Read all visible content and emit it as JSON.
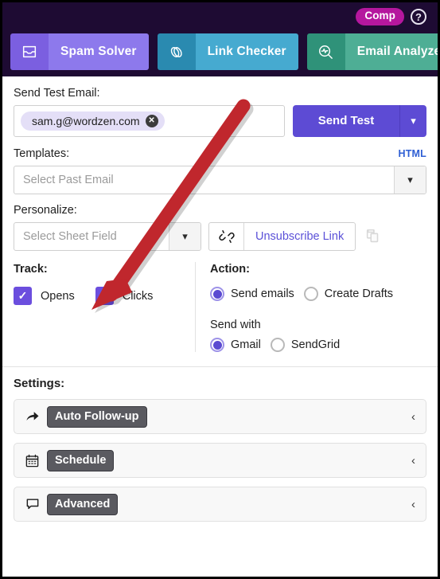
{
  "header": {
    "badge_label": "Comp",
    "help_icon": "question-circle-icon",
    "tools": [
      {
        "icon": "inbox-icon",
        "label": "Spam Solver"
      },
      {
        "icon": "link-icon",
        "label": "Link Checker"
      },
      {
        "icon": "magnifier-pulse-icon",
        "label": "Email Analyzer"
      }
    ]
  },
  "send_test": {
    "label": "Send Test Email:",
    "chip_value": "sam.g@wordzen.com",
    "chip_remove_icon": "close-circle-icon",
    "button_label": "Send Test",
    "button_caret_icon": "chevron-down-icon"
  },
  "templates": {
    "label": "Templates:",
    "html_link": "HTML",
    "placeholder": "Select Past Email",
    "caret_icon": "chevron-down-icon"
  },
  "personalize": {
    "label": "Personalize:",
    "placeholder": "Select Sheet Field",
    "caret_icon": "chevron-down-icon",
    "unsubscribe_icon": "broken-link-icon",
    "unsubscribe_label": "Unsubscribe Link",
    "copy_icon": "copy-icon"
  },
  "track": {
    "label": "Track:",
    "items": [
      {
        "label": "Opens",
        "checked": true
      },
      {
        "label": "Clicks",
        "checked": true
      }
    ]
  },
  "action": {
    "label": "Action:",
    "options": [
      {
        "label": "Send emails",
        "selected": true
      },
      {
        "label": "Create Drafts",
        "selected": false
      }
    ],
    "send_with_label": "Send with",
    "send_with_options": [
      {
        "label": "Gmail",
        "selected": true
      },
      {
        "label": "SendGrid",
        "selected": false
      }
    ]
  },
  "settings": {
    "title": "Settings:",
    "rows": [
      {
        "icon": "forward-arrow-icon",
        "label": "Auto Follow-up",
        "caret": "chevron-left-icon"
      },
      {
        "icon": "calendar-icon",
        "label": "Schedule",
        "caret": "chevron-left-icon"
      },
      {
        "icon": "speech-bubble-icon",
        "label": "Advanced",
        "caret": "chevron-left-icon"
      }
    ]
  },
  "annotation": {
    "type": "arrow",
    "color": "#c0272d",
    "points_to": "Clicks checkbox"
  },
  "colors": {
    "toolbar_bg": "#1e0b33",
    "badge": "#b5179e",
    "spam_solver": "#8d79ec",
    "link_checker": "#46aad0",
    "email_analyzer": "#4eae95",
    "primary_button": "#5d4bd4",
    "checkbox": "#6b4ede",
    "radio": "#5b4bd1",
    "link": "#2f5fd4",
    "unsubscribe_link": "#5b51d8",
    "badge_dark": "#5a5a60",
    "annotation": "#c0272d"
  }
}
